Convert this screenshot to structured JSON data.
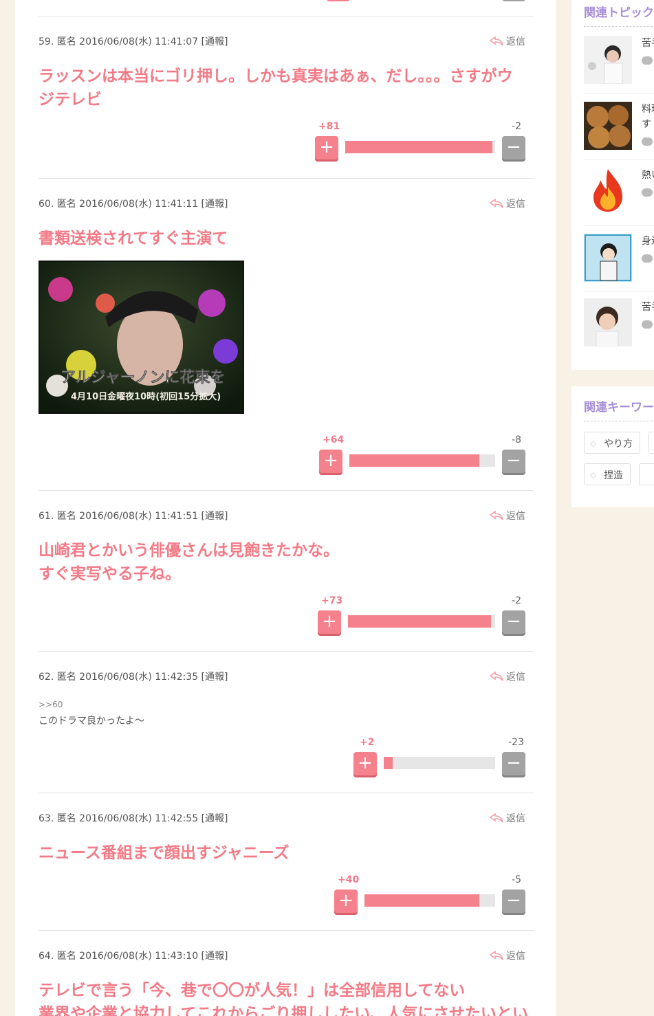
{
  "comments": [
    {
      "meta": "59. 匿名 2016/06/08(水) 11:41:07 [通報]",
      "reply": "返信",
      "lines": [
        "ラッスンは本当にゴリ押し。しかも真実はあぁ、だし。。。さすがウ",
        "ジテレビ"
      ],
      "plus": "+81",
      "minus": "-2",
      "ratio": 0.98
    },
    {
      "meta": "60. 匿名 2016/06/08(水) 11:41:11 [通報]",
      "reply": "返信",
      "lines": [
        "書類送検されてすぐ主演て"
      ],
      "image_caption": "アルジャーノンに花束を",
      "image_date": "4月10日金曜夜10時(初回15分拡大)",
      "plus": "+64",
      "minus": "-8",
      "ratio": 0.89
    },
    {
      "meta": "61. 匿名 2016/06/08(水) 11:41:51 [通報]",
      "reply": "返信",
      "lines": [
        "山崎君とかいう俳優さんは見飽きたかな。",
        "すぐ実写やる子ね。"
      ],
      "plus": "+73",
      "minus": "-2",
      "ratio": 0.97
    },
    {
      "meta": "62. 匿名 2016/06/08(水) 11:42:35 [通報]",
      "reply": "返信",
      "anchor": ">>60",
      "small": "このドラマ良かったよ〜",
      "plus": "+2",
      "minus": "-23",
      "ratio": 0.08
    },
    {
      "meta": "63. 匿名 2016/06/08(水) 11:42:55 [通報]",
      "reply": "返信",
      "lines": [
        "ニュース番組まで顔出すジャニーズ"
      ],
      "plus": "+40",
      "minus": "-5",
      "ratio": 0.88
    },
    {
      "meta": "64. 匿名 2016/06/08(水) 11:43:10 [通報]",
      "reply": "返信",
      "lines": [
        "テレビで言う「今、巷で〇〇が人気！」は全部信用してない",
        "業界や企業と協力してこれからごり押ししたい、人気にさせたいとい"
      ]
    }
  ],
  "sidebar": {
    "related_topics_title": "関連トピック",
    "topics": [
      {
        "text": "苦手"
      },
      {
        "text": "料理",
        "text2": "す"
      },
      {
        "text": "熱い"
      },
      {
        "text": "身近"
      },
      {
        "text": "苦手"
      }
    ],
    "keywords_title": "関連キーワード",
    "tags": [
      "やり方",
      "捏造"
    ]
  },
  "colors": {
    "accent": "#f37a86",
    "plus_button": "#f4818b",
    "minus_button": "#a3a3a3",
    "sidebar_heading": "#a68ed8",
    "page_bg": "#f8f1e6"
  }
}
